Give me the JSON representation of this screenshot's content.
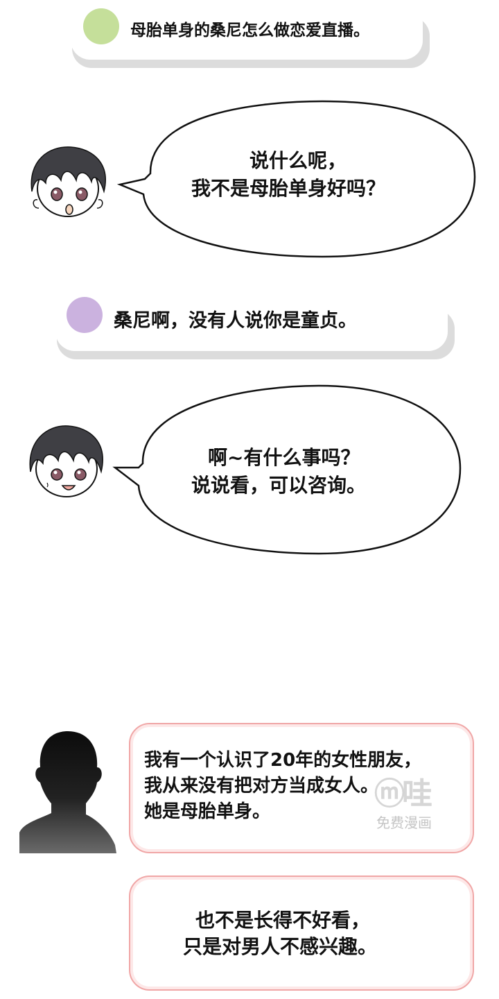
{
  "chat": [
    {
      "text": "母胎单身的桑尼怎么做恋爱直播。",
      "dot_color": "#c5df9a"
    },
    {
      "text": "桑尼啊，没有人说你是童贞。",
      "dot_color": "#cbb2df"
    }
  ],
  "bubbles": [
    {
      "line1": "说什么呢，",
      "line2": "我不是母胎单身好吗？"
    },
    {
      "line1": "啊~有什么事吗？",
      "line2": "说说看，可以咨询。"
    }
  ],
  "caller": [
    {
      "line1": "我有一个认识了20年的女性朋友，",
      "line2": "我从来没有把对方当成女人。",
      "line3": "她是母胎单身。"
    },
    {
      "line1": "也不是长得不好看，",
      "line2": "只是对男人不感兴趣。"
    }
  ],
  "watermark": {
    "logo": "ⓜ哇",
    "text": "免费漫画"
  },
  "colors": {
    "caller_border": "#f0a6a6",
    "avatar_hair": "#3f3f44",
    "eye": "#8a5a66"
  }
}
